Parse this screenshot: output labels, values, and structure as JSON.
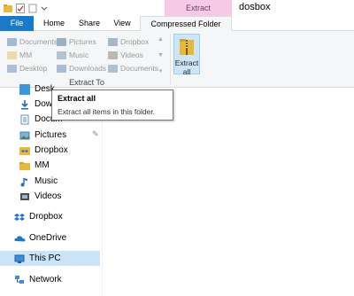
{
  "window": {
    "title": "dosbox"
  },
  "ribbon": {
    "context_header": "Extract",
    "tabs": [
      {
        "label": "File"
      },
      {
        "label": "Home"
      },
      {
        "label": "Share"
      },
      {
        "label": "View"
      },
      {
        "label": "Compressed Folder Tools"
      }
    ],
    "destinations": [
      {
        "label": "Documents"
      },
      {
        "label": "Pictures"
      },
      {
        "label": "Dropbox"
      },
      {
        "label": "MM"
      },
      {
        "label": "Music"
      },
      {
        "label": "Videos"
      },
      {
        "label": "Desktop"
      },
      {
        "label": "Downloads"
      },
      {
        "label": "Documents"
      }
    ],
    "group_label": "Extract To",
    "extract_all": {
      "line1": "Extract",
      "line2": "all"
    }
  },
  "tooltip": {
    "title": "Extract all",
    "description": "Extract all items in this folder."
  },
  "nav": {
    "quick_access": [
      {
        "label": "Desk"
      },
      {
        "label": "Dow"
      },
      {
        "label": "Docum"
      },
      {
        "label": "Pictures"
      },
      {
        "label": "Dropbox"
      },
      {
        "label": "MM"
      },
      {
        "label": "Music"
      },
      {
        "label": "Videos"
      }
    ],
    "roots": [
      {
        "label": "Dropbox"
      },
      {
        "label": "OneDrive"
      },
      {
        "label": "This PC"
      },
      {
        "label": "Network"
      }
    ]
  },
  "colors": {
    "accent": "#1979ca",
    "context_tab": "#f6c9e6",
    "selection": "#cce4f7",
    "folder": "#e8b839"
  }
}
